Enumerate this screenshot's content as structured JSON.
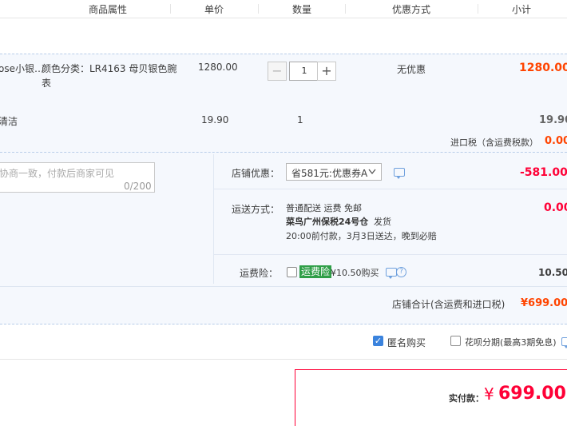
{
  "header": {
    "col_attr": "商品属性",
    "col_price": "单价",
    "col_qty": "数量",
    "col_discount": "优惠方式",
    "col_subtotal": "小计"
  },
  "item1": {
    "title_fragment": "ose小银…",
    "attr_line1": "颜色分类：LR4163 母贝银色腕",
    "attr_line2": "表",
    "unit_price": "1280.00",
    "minus": "−",
    "qty": "1",
    "plus": "+",
    "discount": "无优惠",
    "subtotal": "1280.00"
  },
  "item2": {
    "title_fragment": "清洁",
    "unit_price": "19.90",
    "qty": "1",
    "subtotal": "19.90"
  },
  "import_tax": {
    "label": "进口税（含运费税款）",
    "value": "0.00"
  },
  "message": {
    "placeholder": "协商一致，付款后商家可见",
    "counter": "0/200"
  },
  "shop_coupon": {
    "label": "店铺优惠：",
    "selected": "省581元:优惠券A",
    "value": "-581.00"
  },
  "shipping": {
    "label": "运送方式：",
    "line1": "普通配送 运费 免邮",
    "warehouse": "菜鸟广州保税24号仓",
    "ship_word": "发货",
    "line3": "20:00前付款，3月3日送达，晚到必赔",
    "value": "0.00"
  },
  "insurance": {
    "label": "运费险：",
    "tag": "运费险",
    "price_text": "¥10.50购买",
    "value": "10.50"
  },
  "shop_total": {
    "label": "店铺合计(含运费和进口税)",
    "value": "¥699.00"
  },
  "options": {
    "anonymous": "匿名购买",
    "huabei": "花呗分期(最高3期免息)"
  },
  "payment": {
    "label": "实付款：",
    "currency": "¥",
    "amount": "699.00"
  },
  "colors": {
    "price_red": "#ff4400",
    "pay_red": "#ff0036",
    "accent_blue": "#3b83dd",
    "tag_green": "#2e9e47"
  }
}
